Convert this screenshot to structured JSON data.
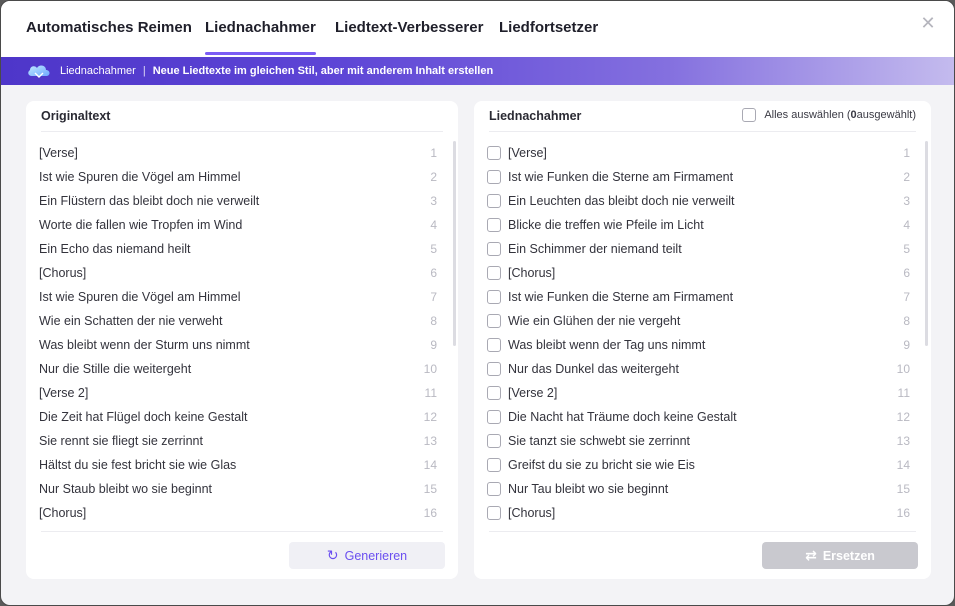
{
  "tabs": [
    {
      "label": "Automatisches Reimen"
    },
    {
      "label": "Liednachahmer",
      "active": true
    },
    {
      "label": "Liedtext-Verbesserer"
    },
    {
      "label": "Liedfortsetzer"
    }
  ],
  "close_icon": "close-icon",
  "banner": {
    "name": "Liednachahmer",
    "separator": "|",
    "description": "Neue Liedtexte im gleichen Stil, aber mit anderem Inhalt erstellen",
    "gradient_start": "#4e36c9",
    "gradient_end": "#c4bbee"
  },
  "left_panel": {
    "title": "Originaltext",
    "lines": [
      {
        "text": "[Verse]",
        "num": "1"
      },
      {
        "text": "Ist wie Spuren die Vögel am Himmel",
        "num": "2"
      },
      {
        "text": "Ein Flüstern das bleibt doch nie verweilt",
        "num": "3"
      },
      {
        "text": "Worte die fallen wie Tropfen im Wind",
        "num": "4"
      },
      {
        "text": "Ein Echo das niemand heilt",
        "num": "5"
      },
      {
        "text": "[Chorus]",
        "num": "6"
      },
      {
        "text": "Ist wie Spuren die Vögel am Himmel",
        "num": "7"
      },
      {
        "text": "Wie ein Schatten der nie verweht",
        "num": "8"
      },
      {
        "text": "Was bleibt wenn der Sturm uns nimmt",
        "num": "9"
      },
      {
        "text": "Nur die Stille die weitergeht",
        "num": "10"
      },
      {
        "text": "[Verse 2]",
        "num": "11"
      },
      {
        "text": "Die Zeit hat Flügel doch keine Gestalt",
        "num": "12"
      },
      {
        "text": "Sie rennt sie fliegt sie zerrinnt",
        "num": "13"
      },
      {
        "text": "Hältst du sie fest bricht sie wie Glas",
        "num": "14"
      },
      {
        "text": "Nur Staub bleibt wo sie beginnt",
        "num": "15"
      },
      {
        "text": "[Chorus]",
        "num": "16"
      }
    ],
    "button_label": "Generieren"
  },
  "right_panel": {
    "title": "Liednachahmer",
    "select_all_label": "Alles auswählen (",
    "selected_count": "0",
    "selected_suffix": " ausgewählt)",
    "lines": [
      {
        "text": "[Verse]",
        "num": "1"
      },
      {
        "text": "Ist wie Funken die Sterne am Firmament",
        "num": "2"
      },
      {
        "text": "Ein Leuchten das bleibt doch nie verweilt",
        "num": "3"
      },
      {
        "text": "Blicke die treffen wie Pfeile im Licht",
        "num": "4"
      },
      {
        "text": "Ein Schimmer der niemand teilt",
        "num": "5"
      },
      {
        "text": "[Chorus]",
        "num": "6"
      },
      {
        "text": "Ist wie Funken die Sterne am Firmament",
        "num": "7"
      },
      {
        "text": "Wie ein Glühen der nie vergeht",
        "num": "8"
      },
      {
        "text": "Was bleibt wenn der Tag uns nimmt",
        "num": "9"
      },
      {
        "text": "Nur das Dunkel das weitergeht",
        "num": "10"
      },
      {
        "text": "[Verse 2]",
        "num": "11"
      },
      {
        "text": "Die Nacht hat Träume doch keine Gestalt",
        "num": "12"
      },
      {
        "text": "Sie tanzt sie schwebt sie zerrinnt",
        "num": "13"
      },
      {
        "text": "Greifst du sie zu bricht sie wie Eis",
        "num": "14"
      },
      {
        "text": "Nur Tau bleibt wo sie beginnt",
        "num": "15"
      },
      {
        "text": "[Chorus]",
        "num": "16"
      }
    ],
    "button_label": "Ersetzen"
  },
  "colors": {
    "accent": "#7b5cf5",
    "disabled_button": "#c9c9cf"
  }
}
